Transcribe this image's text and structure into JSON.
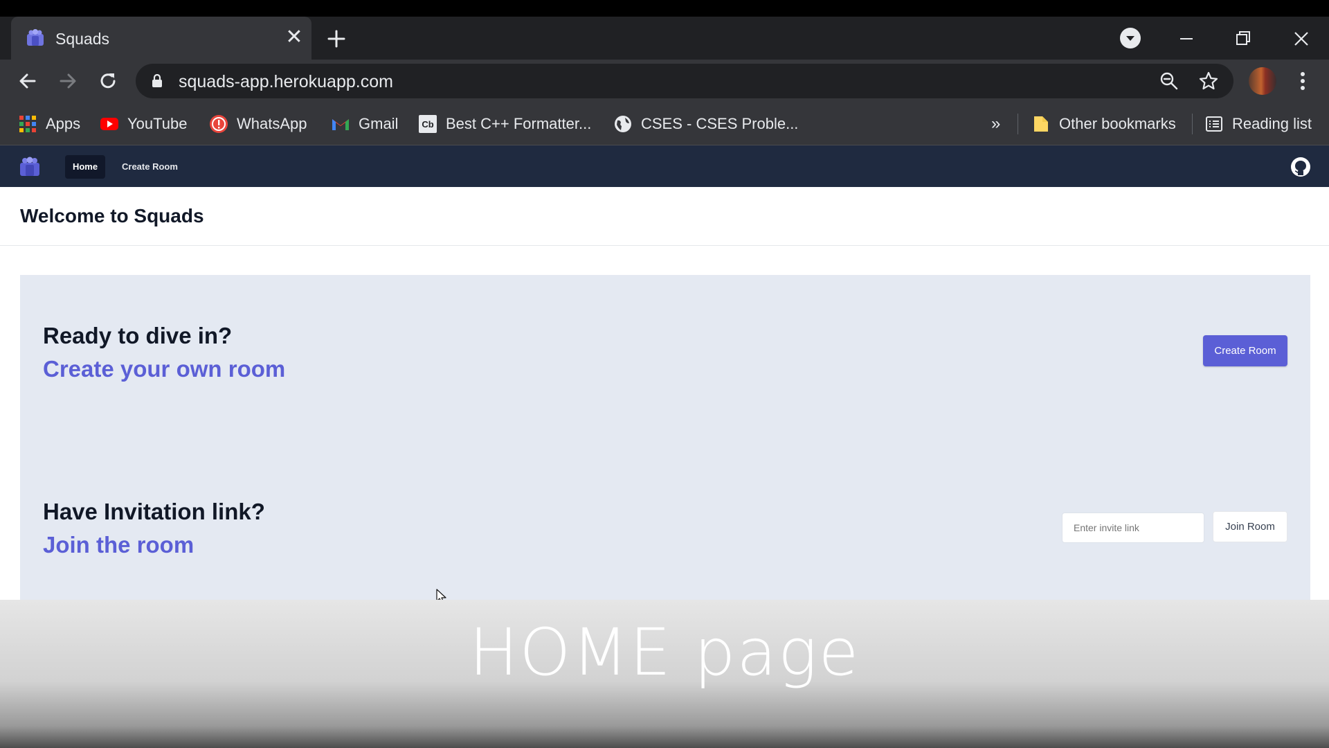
{
  "browser": {
    "tab": {
      "title": "Squads"
    },
    "address": {
      "url": "squads-app.herokuapp.com"
    },
    "bookmarks": [
      {
        "label": "Apps",
        "icon": "apps-grid-icon"
      },
      {
        "label": "YouTube",
        "icon": "youtube-icon"
      },
      {
        "label": "WhatsApp",
        "icon": "whatsapp-icon"
      },
      {
        "label": "Gmail",
        "icon": "gmail-icon"
      },
      {
        "label": "Best C++ Formatter...",
        "icon": "codebeautify-icon"
      },
      {
        "label": "CSES - CSES Proble...",
        "icon": "globe-icon"
      }
    ],
    "overflow_label": "»",
    "other_bookmarks": "Other bookmarks",
    "reading_list": "Reading list"
  },
  "app": {
    "nav": {
      "home": "Home",
      "create_room": "Create Room"
    },
    "page_title": "Welcome to Squads",
    "create": {
      "question": "Ready to dive in?",
      "cta": "Create your own room",
      "button": "Create Room"
    },
    "join": {
      "question": "Have Invitation link?",
      "cta": "Join the room",
      "input_placeholder": "Enter invite link",
      "button": "Join Room"
    }
  },
  "caption": "HOME page",
  "colors": {
    "accent": "#5b5fd6",
    "navbar": "#1f2a40",
    "panel": "#e4e9f2",
    "chrome_dark": "#202124",
    "chrome": "#35363a"
  }
}
